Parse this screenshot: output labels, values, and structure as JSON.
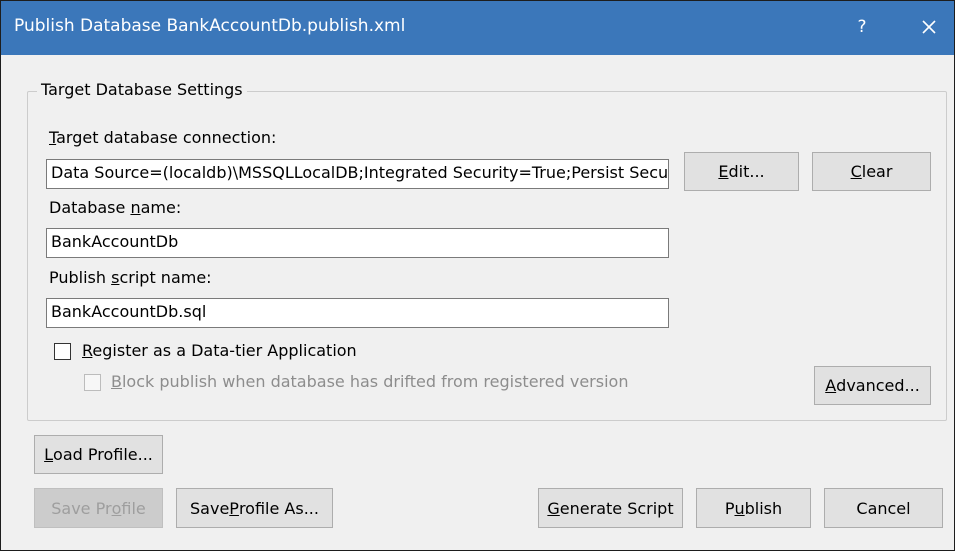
{
  "window": {
    "title": "Publish Database BankAccountDb.publish.xml",
    "help_label": "?",
    "titlebar_color": "#3b77ba"
  },
  "target_settings": {
    "group_title": "Target Database Settings",
    "connection_label": {
      "pre": "",
      "key": "T",
      "post": "arget database connection:"
    },
    "connection_value": "Data Source=(localdb)\\MSSQLLocalDB;Integrated Security=True;Persist Secu",
    "edit_button": {
      "pre": "",
      "key": "E",
      "post": "dit..."
    },
    "clear_button": {
      "pre": "",
      "key": "C",
      "post": "lear"
    },
    "database_name_label": {
      "pre": "Database ",
      "key": "n",
      "post": "ame:"
    },
    "database_name_value": "BankAccountDb",
    "script_name_label": {
      "pre": "Publish ",
      "key": "s",
      "post": "cript name:"
    },
    "script_name_value": "BankAccountDb.sql",
    "register_checkbox": {
      "pre": "",
      "key": "R",
      "post": "egister as a Data-tier Application",
      "checked": false
    },
    "block_checkbox": {
      "pre": "",
      "key": "B",
      "post": "lock publish when database has drifted from registered version",
      "checked": false,
      "enabled": false
    },
    "advanced_button": {
      "pre": "",
      "key": "A",
      "post": "dvanced..."
    }
  },
  "footer": {
    "load_profile_button": {
      "pre": "",
      "key": "L",
      "post": "oad Profile..."
    },
    "save_profile_button": {
      "pre": "Save Pr",
      "key": "o",
      "post": "file",
      "enabled": false
    },
    "save_profile_as_button": {
      "pre": "Save ",
      "key": "P",
      "post": "rofile As..."
    },
    "generate_script_button": {
      "pre": "",
      "key": "G",
      "post": "enerate Script"
    },
    "publish_button": {
      "pre": "P",
      "key": "u",
      "post": "blish"
    },
    "cancel_button": {
      "pre": "Cancel",
      "key": "",
      "post": ""
    }
  }
}
